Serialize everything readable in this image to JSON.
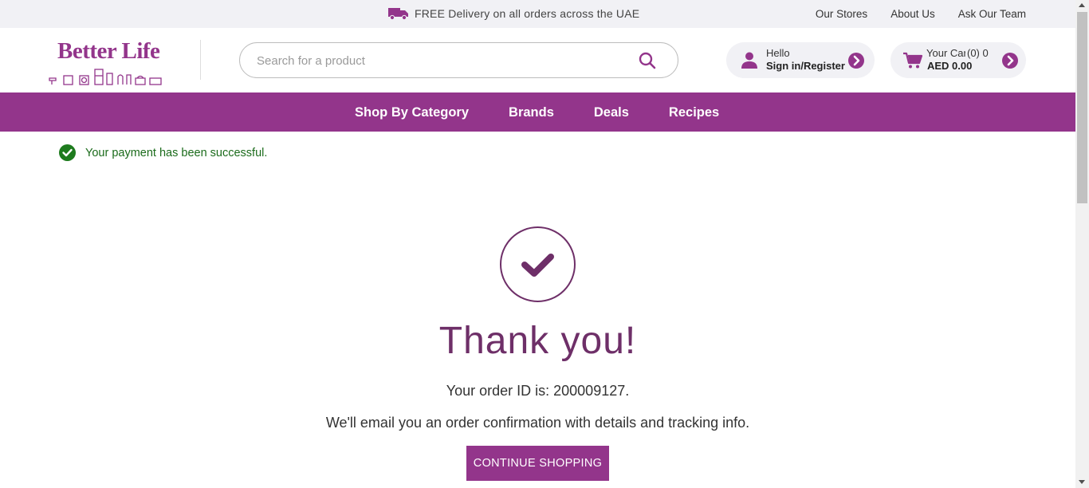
{
  "topbar": {
    "promo_icon": "delivery-truck-icon",
    "promo_text": "FREE Delivery on all orders across the UAE",
    "links": [
      "Our Stores",
      "About Us",
      "Ask Our Team"
    ]
  },
  "header": {
    "logo_text": "Better Life",
    "search": {
      "placeholder": "Search for a product",
      "value": ""
    },
    "account": {
      "greeting": "Hello",
      "action": "Sign in/Register"
    },
    "cart": {
      "label": "Your Cart",
      "count": "(0) 0",
      "total": "AED 0.00"
    }
  },
  "nav": {
    "items": [
      "Shop By Category",
      "Brands",
      "Deals",
      "Recipes"
    ]
  },
  "notice": {
    "text": "Your payment has been successful."
  },
  "confirmation": {
    "heading": "Thank you!",
    "order_id_text": "Your order ID is: 200009127.",
    "email_text": "We'll email you an order confirmation with details and tracking info.",
    "button_label": "CONTINUE SHOPPING"
  },
  "colors": {
    "brand": "#93358b",
    "heading": "#6e2f68",
    "success": "#1e7b1e",
    "topbar_bg": "#f1f1f5"
  }
}
